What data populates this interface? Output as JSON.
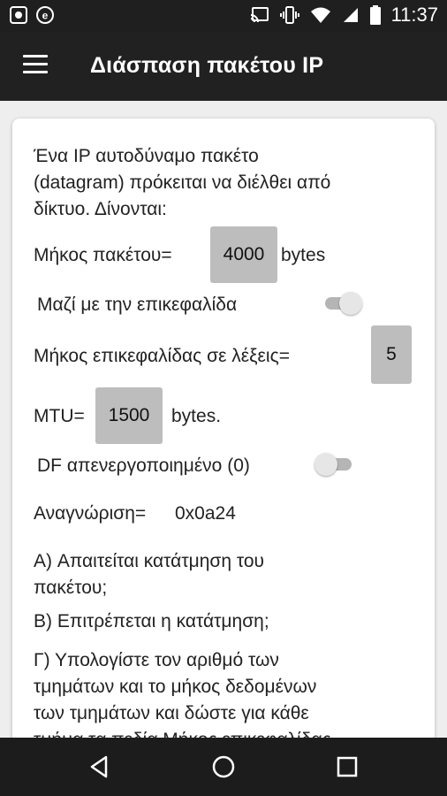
{
  "status_bar": {
    "time": "11:37",
    "left_icons": [
      "screenshot-icon",
      "e-badge-icon"
    ],
    "right_icons": [
      "cast-icon",
      "vibrate-icon",
      "wifi-icon",
      "signal-icon",
      "battery-icon"
    ]
  },
  "app_bar": {
    "title": "Διάσπαση πακέτου IP",
    "menu_icon": "menu-icon"
  },
  "content": {
    "intro_line1": "Ένα IP αυτοδύναμο πακέτο",
    "intro_line2": "(datagram) πρόκειται να διέλθει από",
    "intro_line3": "δίκτυο. Δίνονται:",
    "packet_length_label": "Μήκος πακέτου=",
    "packet_length_value": "4000",
    "packet_length_unit": "bytes",
    "with_header_label": "Μαζί με την επικεφαλίδα",
    "with_header_on": true,
    "header_words_label": "Μήκος επικεφαλίδας σε λέξεις=",
    "header_words_value": "5",
    "mtu_label": "MTU=",
    "mtu_value": "1500",
    "mtu_unit": "bytes.",
    "df_label": "DF απενεργοποιημένο (0)",
    "df_on": false,
    "identification_label": "Αναγνώριση=",
    "identification_value": "0x0a24",
    "question_a_line1": "A) Απαιτείται κατάτμηση του",
    "question_a_line2": "πακέτου;",
    "question_b": "B) Επιτρέπεται η κατάτμηση;",
    "question_c_line1": "Γ) Υπολογίστε τον αριθμό των",
    "question_c_line2": "τμημάτων και το μήκος δεδομένων",
    "question_c_line3": "των τμημάτων και δώστε για κάθε",
    "question_c_line4": "τμήμα τα πεδία Μήκος επικεφαλίδας"
  },
  "nav_bar": {
    "back_icon": "back-icon",
    "home_icon": "home-icon",
    "recents_icon": "recents-icon"
  },
  "colors": {
    "status_bar": "#1f1f1f",
    "app_bar": "#212121",
    "background": "#eeeeee",
    "card": "#ffffff",
    "value_box": "#bdbdbd"
  }
}
